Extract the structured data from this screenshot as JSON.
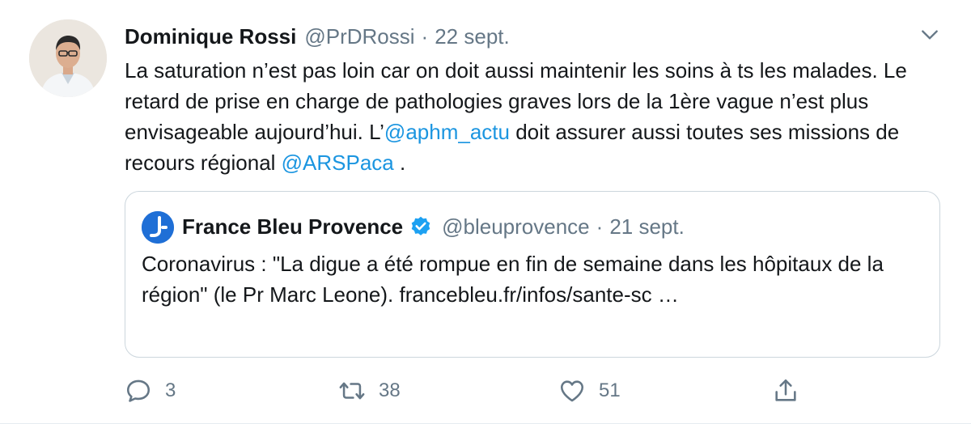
{
  "author": {
    "display_name": "Dominique Rossi",
    "handle": "@PrDRossi",
    "date": "22 sept."
  },
  "tweet": {
    "segments": [
      {
        "type": "text",
        "value": "La saturation n’est pas loin car on doit aussi maintenir les soins à ts les malades. Le retard de prise en charge de pathologies graves lors de la 1ère vague n’est plus envisageable aujourd’hui. L’"
      },
      {
        "type": "mention",
        "value": "@aphm_actu"
      },
      {
        "type": "text",
        "value": " doit assurer aussi toutes ses missions de recours régional "
      },
      {
        "type": "mention",
        "value": "@ARSPaca"
      },
      {
        "type": "text",
        "value": " ."
      }
    ]
  },
  "quoted": {
    "display_name": "France Bleu Provence",
    "verified": true,
    "handle": "@bleuprovence",
    "date": "21 sept.",
    "text": "Coronavirus : \"La digue a été rompue en fin de semaine dans les hôpitaux de la région\" (le Pr Marc Leone). francebleu.fr/infos/sante-sc …"
  },
  "actions": {
    "reply_count": "3",
    "retweet_count": "38",
    "like_count": "51"
  },
  "icons": {
    "caret": "chevron-down-icon",
    "reply": "comment-icon",
    "retweet": "retweet-icon",
    "like": "heart-icon",
    "share": "share-icon",
    "verified": "verified-badge-icon"
  },
  "colors": {
    "link": "#1b95e0",
    "muted": "#657786",
    "border": "#ccd6dd",
    "verified": "#1da1f2",
    "france_bleu": "#1f6fd6"
  }
}
